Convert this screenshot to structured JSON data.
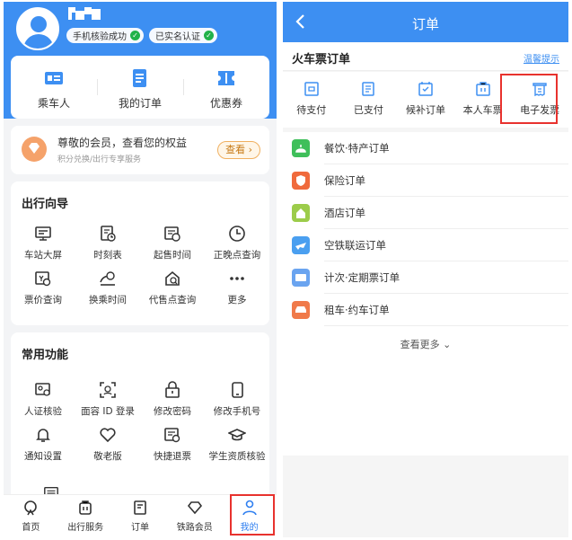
{
  "profile": {
    "badges": [
      {
        "label": "手机核验成功"
      },
      {
        "label": "已实名认证"
      }
    ]
  },
  "quick_links": [
    {
      "label": "乘车人",
      "icon": "passenger-icon"
    },
    {
      "label": "我的订单",
      "icon": "orders-icon"
    },
    {
      "label": "优惠券",
      "icon": "coupon-icon"
    }
  ],
  "member_banner": {
    "title": "尊敬的会员，查看您的权益",
    "subtitle": "积分兑换/出行专享服务",
    "button": "查看"
  },
  "travel_guide": {
    "title": "出行向导",
    "items": [
      {
        "label": "车站大屏",
        "icon": "station-screen-icon"
      },
      {
        "label": "时刻表",
        "icon": "timetable-icon"
      },
      {
        "label": "起售时间",
        "icon": "sale-time-icon"
      },
      {
        "label": "正晚点查询",
        "icon": "clock-icon"
      },
      {
        "label": "票价查询",
        "icon": "fare-query-icon"
      },
      {
        "label": "换乘时间",
        "icon": "transfer-time-icon"
      },
      {
        "label": "代售点查询",
        "icon": "agency-query-icon"
      },
      {
        "label": "更多",
        "icon": "more-icon"
      }
    ]
  },
  "common_functions": {
    "title": "常用功能",
    "items": [
      {
        "label": "人证核验",
        "icon": "id-verify-icon"
      },
      {
        "label": "面容 ID 登录",
        "icon": "face-id-icon"
      },
      {
        "label": "修改密码",
        "icon": "lock-icon"
      },
      {
        "label": "修改手机号",
        "icon": "phone-icon"
      },
      {
        "label": "通知设置",
        "icon": "bell-icon"
      },
      {
        "label": "敬老版",
        "icon": "heart-icon"
      },
      {
        "label": "快捷退票",
        "icon": "refund-icon"
      },
      {
        "label": "学生资质核验",
        "icon": "graduation-cap-icon"
      }
    ]
  },
  "tabbar": [
    {
      "label": "首页",
      "icon": "home-icon"
    },
    {
      "label": "出行服务",
      "icon": "travel-service-icon"
    },
    {
      "label": "订单",
      "icon": "order-tab-icon"
    },
    {
      "label": "铁路会员",
      "icon": "member-icon"
    },
    {
      "label": "我的",
      "icon": "user-icon",
      "active": true
    }
  ],
  "orders_page": {
    "nav_title": "订单",
    "section_title": "火车票订单",
    "tip_link": "温馨提示",
    "statuses": [
      {
        "label": "待支付",
        "icon": "pending-payment-icon"
      },
      {
        "label": "已支付",
        "icon": "paid-icon"
      },
      {
        "label": "候补订单",
        "icon": "waitlist-icon"
      },
      {
        "label": "本人车票",
        "icon": "own-ticket-icon"
      },
      {
        "label": "电子发票",
        "icon": "e-invoice-icon",
        "highlighted": true
      }
    ],
    "other_orders": [
      {
        "label": "餐饮·特产订单",
        "icon": "food-icon",
        "color": "#3fbf5a"
      },
      {
        "label": "保险订单",
        "icon": "insurance-icon",
        "color": "#f06a3c"
      },
      {
        "label": "酒店订单",
        "icon": "hotel-icon",
        "color": "#9ccc4a"
      },
      {
        "label": "空铁联运订单",
        "icon": "air-rail-icon",
        "color": "#4a9ff0"
      },
      {
        "label": "计次·定期票订单",
        "icon": "period-ticket-icon",
        "color": "#6aa4f0"
      },
      {
        "label": "租车·约车订单",
        "icon": "car-icon",
        "color": "#f07a4a"
      }
    ],
    "more": "查看更多"
  },
  "colors": {
    "primary": "#3d8ff2",
    "highlight_border": "#e8322e"
  }
}
